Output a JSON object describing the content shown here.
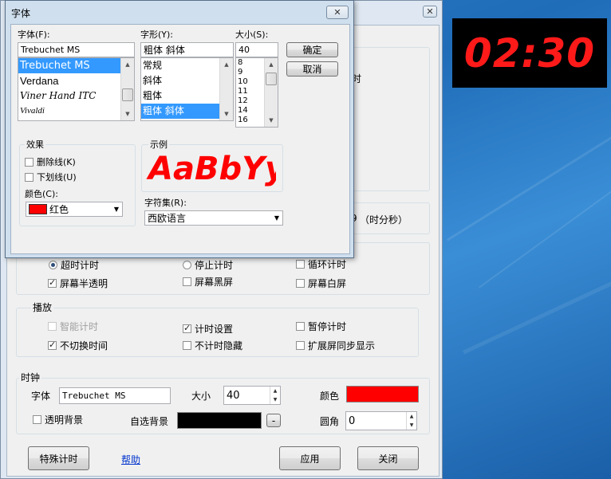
{
  "main_window": {
    "close_glyph": "✕",
    "partial_text_time_right": "时",
    "partial_text_hms": "（时分秒）",
    "partial_text_9": "9",
    "mode_options": [
      {
        "label": "超时计时",
        "selected": true
      },
      {
        "label": "停止计时",
        "selected": false
      },
      {
        "label": "循环计时",
        "checked": false
      }
    ],
    "screen_options": [
      {
        "label": "屏幕半透明",
        "checked": true
      },
      {
        "label": "屏幕黑屏",
        "checked": false
      },
      {
        "label": "屏幕白屏",
        "checked": false
      }
    ],
    "playback": {
      "title": "播放",
      "items": [
        {
          "label": "智能计时",
          "checked": false,
          "disabled": true
        },
        {
          "label": "计时设置",
          "checked": true,
          "disabled": false
        },
        {
          "label": "暂停计时",
          "checked": false,
          "disabled": false
        },
        {
          "label": "不切换时间",
          "checked": true,
          "disabled": false
        },
        {
          "label": "不计时隐藏",
          "checked": false,
          "disabled": false
        },
        {
          "label": "扩展屏同步显示",
          "checked": false,
          "disabled": false
        }
      ]
    },
    "clock_group": {
      "title": "时钟",
      "font_label": "字体",
      "font_value": "Trebuchet MS",
      "size_label": "大小",
      "size_value": "40",
      "color_label": "颜色",
      "color_value": "#ff0000",
      "transparent_bg_label": "透明背景",
      "transparent_bg_checked": false,
      "custom_bg_label": "自选背景",
      "custom_bg_color": "#000000",
      "custom_bg_button": "-",
      "radius_label": "圆角",
      "radius_value": "0"
    },
    "buttons": {
      "special": "特殊计时",
      "help": "帮助",
      "apply": "应用",
      "close": "关闭"
    }
  },
  "font_dialog": {
    "title": "字体",
    "close_glyph": "✕",
    "font_label": "字体(F):",
    "font_value": "Trebuchet MS",
    "font_list": [
      "Trebuchet MS",
      "Verdana",
      "Viner Hand ITC",
      "Vivaldi"
    ],
    "font_selected_index": 0,
    "style_label": "字形(Y):",
    "style_value": "粗体 斜体",
    "style_list": [
      "常规",
      "斜体",
      "粗体",
      "粗体 斜体"
    ],
    "style_selected_index": 3,
    "size_label": "大小(S):",
    "size_value": "40",
    "size_list": [
      "8",
      "9",
      "10",
      "11",
      "12",
      "14",
      "16"
    ],
    "ok_button": "确定",
    "cancel_button": "取消",
    "effects_title": "效果",
    "strikeout_label": "删除线(K)",
    "strikeout_checked": false,
    "underline_label": "下划线(U)",
    "underline_checked": false,
    "color_label": "颜色(C):",
    "color_value": "红色",
    "color_swatch": "#ff0000",
    "sample_title": "示例",
    "sample_text": "AaBbYy",
    "charset_label": "字符集(R):",
    "charset_value": "西欧语言"
  },
  "clock_display": {
    "time": "02:30",
    "text_color": "#ff1a1a",
    "background": "#000000"
  }
}
